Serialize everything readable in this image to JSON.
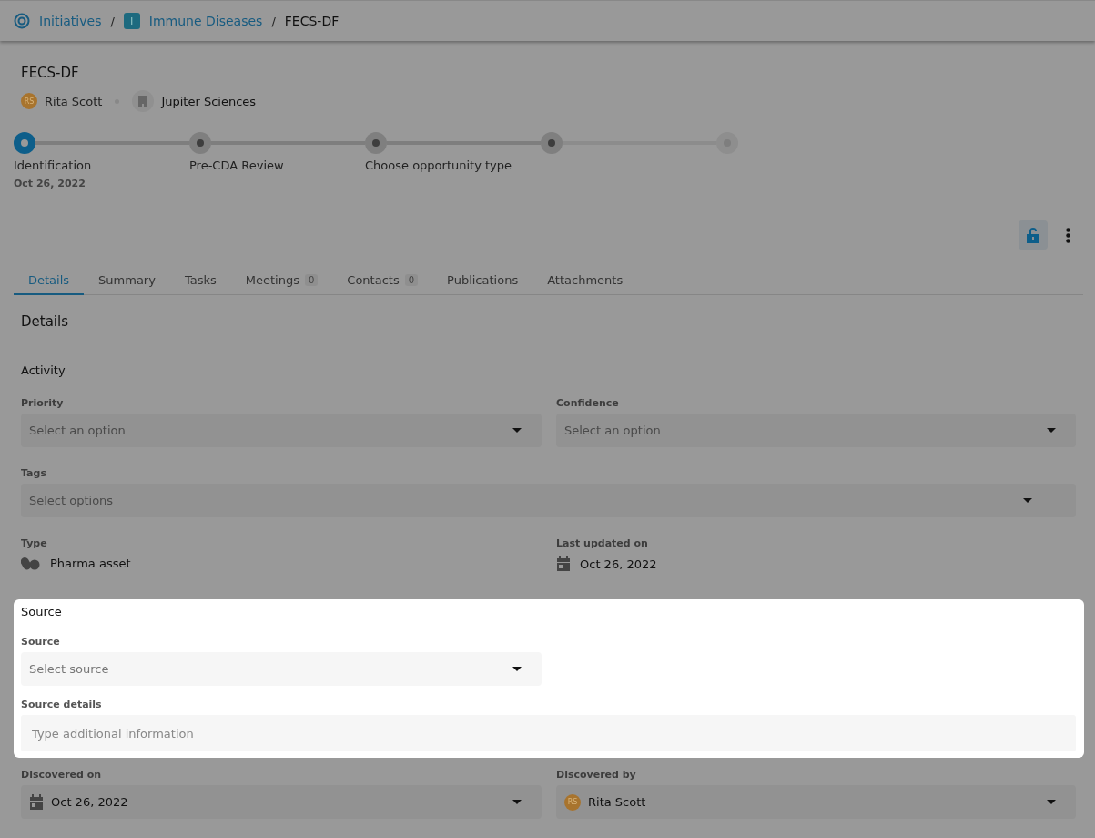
{
  "breadcrumb": [
    {
      "label": "Initiatives",
      "kind": "target"
    },
    {
      "separator": "/",
      "label": "Immune Diseases",
      "kind": "badge",
      "badge": "I"
    },
    {
      "separator": "/",
      "label": "FECS-DF",
      "kind": "current"
    }
  ],
  "title": "FECS-DF",
  "owner": {
    "initials": "RS",
    "name": "Rita Scott"
  },
  "company": "Jupiter Sciences",
  "steps": [
    {
      "label": "Identification",
      "date": "Oct 26, 2022",
      "kind": "current"
    },
    {
      "label": "Pre-CDA Review",
      "kind": "open"
    },
    {
      "label": "Choose opportunity type",
      "kind": "open"
    },
    {
      "kind": "open"
    },
    {
      "kind": "faint"
    }
  ],
  "tabs": [
    {
      "label": "Details",
      "selected": true
    },
    {
      "label": "Summary",
      "selected": false
    },
    {
      "label": "Tasks",
      "selected": false
    },
    {
      "label": "Meetings",
      "count": "0",
      "selected": false
    },
    {
      "label": "Contacts",
      "count": "0",
      "selected": false
    },
    {
      "label": "Publications",
      "selected": false
    },
    {
      "label": "Attachments",
      "selected": false
    }
  ],
  "details_heading": "Details",
  "activity": {
    "heading": "Activity",
    "priority": {
      "label": "Priority",
      "placeholder": "Select an option"
    },
    "confidence": {
      "label": "Confidence",
      "placeholder": "Select an option"
    },
    "tags": {
      "label": "Tags",
      "placeholder": "Select options"
    },
    "type": {
      "label": "Type",
      "value": "Pharma asset"
    },
    "last_updated": {
      "label": "Last updated on",
      "value": "Oct 26, 2022"
    }
  },
  "source": {
    "heading": "Source",
    "source": {
      "label": "Source",
      "placeholder": "Select source"
    },
    "details": {
      "label": "Source details",
      "placeholder": "Type additional information"
    }
  },
  "discovered_on": {
    "label": "Discovered on",
    "value": "Oct 26, 2022"
  },
  "discovered_by": {
    "label": "Discovered by",
    "initials": "RS",
    "value": "Rita Scott"
  }
}
